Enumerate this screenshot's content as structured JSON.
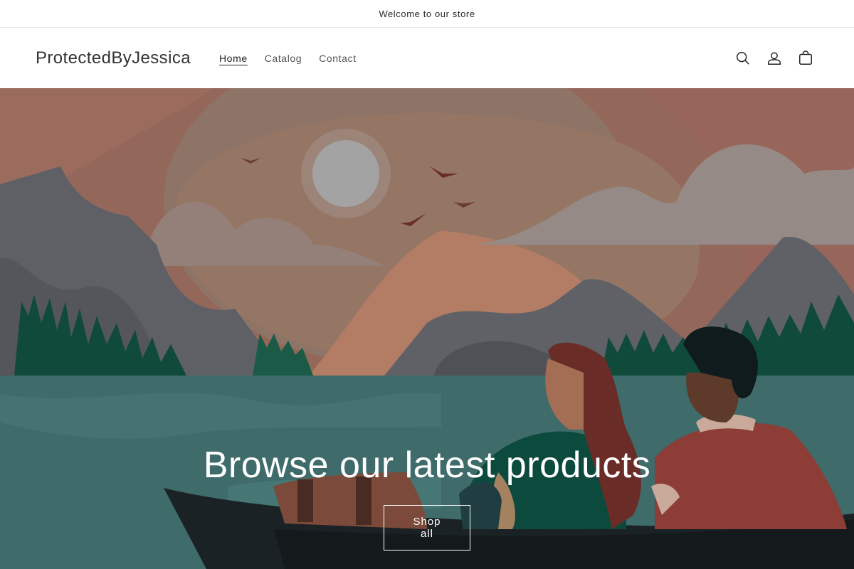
{
  "announcement": {
    "text": "Welcome to our store"
  },
  "header": {
    "logo": "ProtectedByJessica",
    "nav": [
      {
        "label": "Home",
        "active": true
      },
      {
        "label": "Catalog",
        "active": false
      },
      {
        "label": "Contact",
        "active": false
      }
    ],
    "icons": [
      "search-icon",
      "account-icon",
      "cart-icon"
    ]
  },
  "hero": {
    "title": "Browse our latest products",
    "button_label": "Shop all"
  },
  "colors": {
    "sky": "#8f6a5c",
    "water": "#3f6b6b",
    "boat": "#1b2225",
    "mountain": "#5e6066",
    "trees": "#0f4a3b",
    "text": "#ffffff"
  }
}
